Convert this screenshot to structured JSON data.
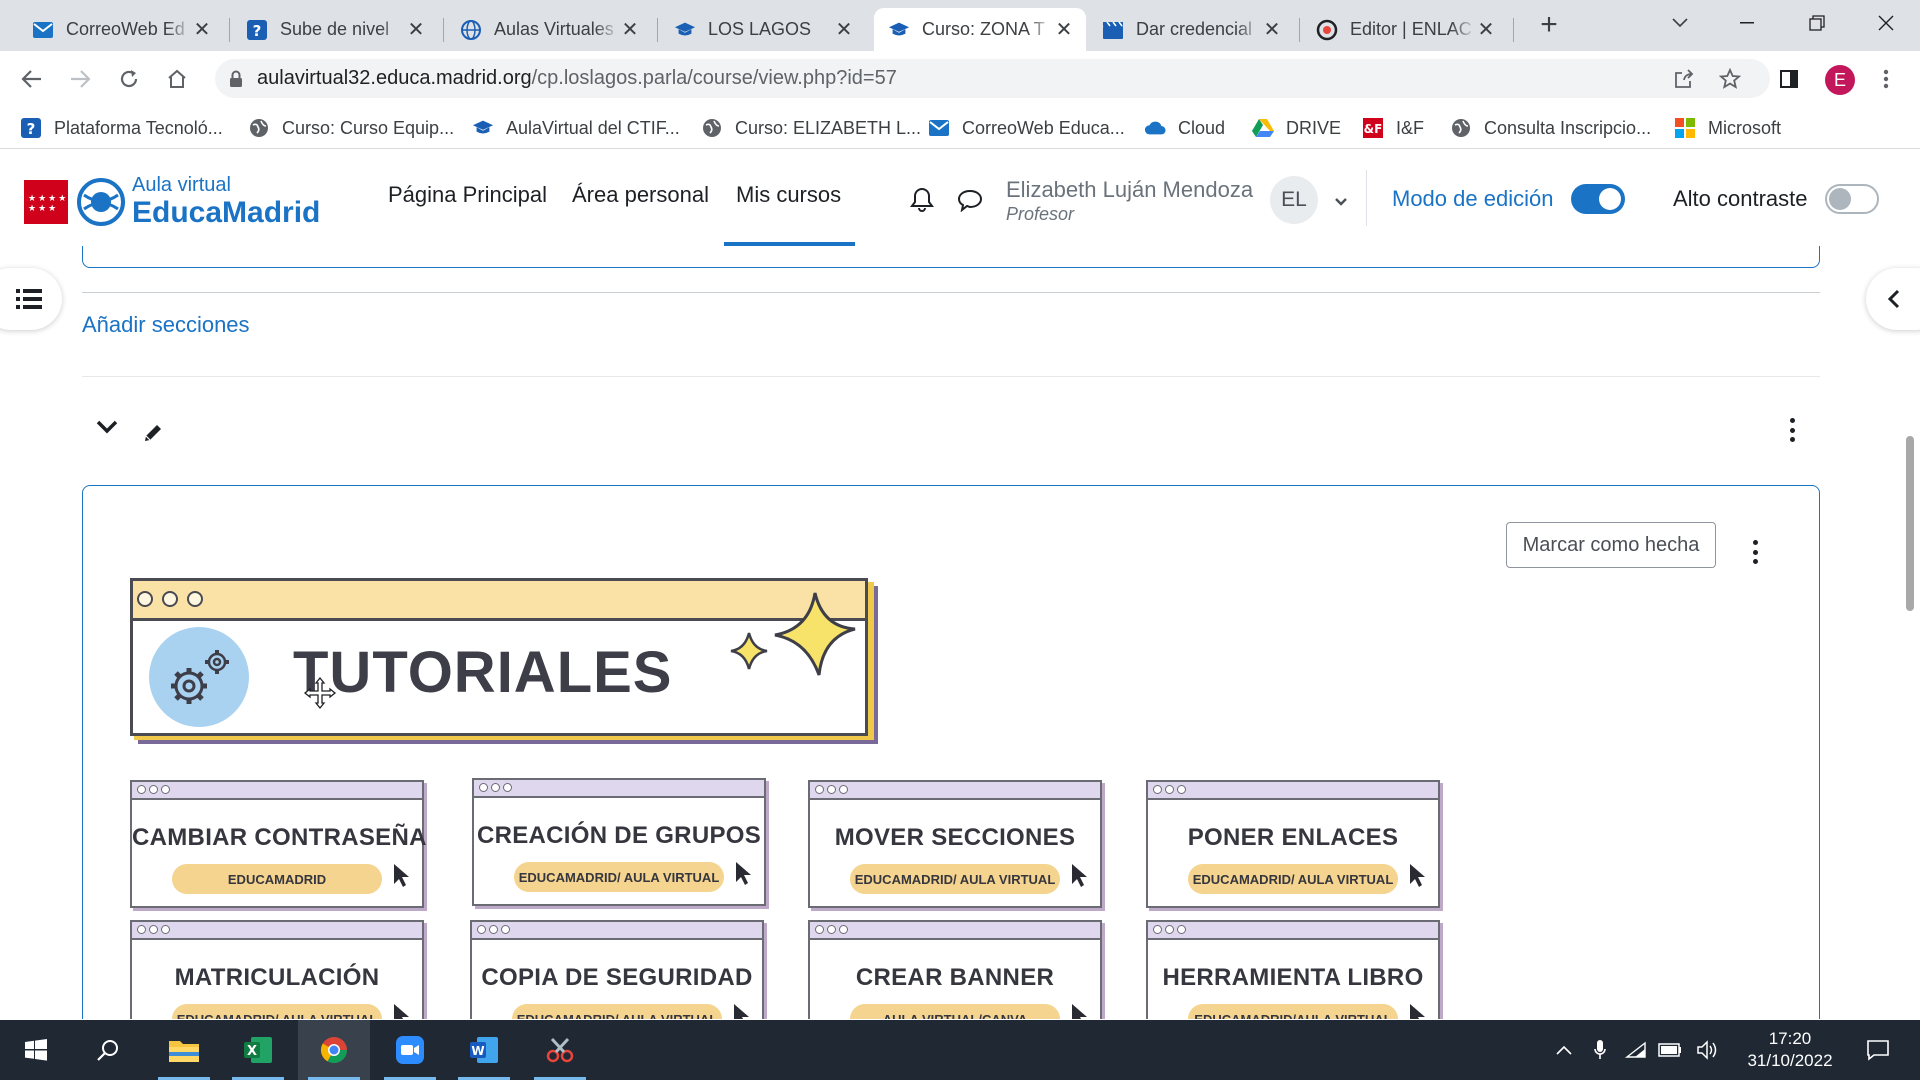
{
  "browser": {
    "tabs": [
      {
        "title": "CorreoWeb Ed",
        "icon": "mail-icon"
      },
      {
        "title": "Sube de nivel",
        "icon": "help-icon"
      },
      {
        "title": "Aulas Virtuales",
        "icon": "globe-icon"
      },
      {
        "title": "LOS LAGOS",
        "icon": "mortarboard-icon"
      },
      {
        "title": "Curso: ZONA T",
        "icon": "mortarboard-icon",
        "active": true
      },
      {
        "title": "Dar credencial",
        "icon": "clapper-icon"
      },
      {
        "title": "Editor | ENLAC",
        "icon": "editor-icon"
      }
    ],
    "url_host": "aulavirtual32.educa.madrid.org",
    "url_path": "/cp.loslagos.parla/course/view.php?id=57",
    "profile_initial": "E",
    "bookmarks": [
      {
        "label": "Plataforma Tecnoló...",
        "icon": "help-icon"
      },
      {
        "label": "Curso: Curso Equip...",
        "icon": "globe-icon"
      },
      {
        "label": "AulaVirtual del CTIF...",
        "icon": "mortarboard-icon"
      },
      {
        "label": "Curso: ELIZABETH L...",
        "icon": "globe-icon"
      },
      {
        "label": "CorreoWeb Educa...",
        "icon": "mail-icon"
      },
      {
        "label": "Cloud",
        "icon": "cloud-icon"
      },
      {
        "label": "DRIVE",
        "icon": "drive-icon"
      },
      {
        "label": "I&F",
        "icon": "if-icon"
      },
      {
        "label": "Consulta Inscripcio...",
        "icon": "globe-icon"
      },
      {
        "label": "Microsoft",
        "icon": "microsoft-icon"
      }
    ]
  },
  "site": {
    "brand_small": "Aula virtual",
    "brand_big": "EducaMadrid",
    "nav": [
      "Página Principal",
      "Área personal",
      "Mis cursos"
    ],
    "user_name": "Elizabeth Luján Mendoza",
    "user_role": "Profesor",
    "user_initials": "EL",
    "edit_mode_label": "Modo de edición",
    "edit_mode_on": true,
    "contrast_label": "Alto contraste",
    "contrast_on": false
  },
  "course": {
    "add_sections": "Añadir secciones",
    "mark_done": "Marcar como hecha",
    "banner_title": "TUTORIALES",
    "tiles": [
      {
        "title": "CAMBIAR CONTRASEÑA",
        "subtitle": "EDUCAMADRID"
      },
      {
        "title": "CREACIÓN DE GRUPOS",
        "subtitle": "EDUCAMADRID/ AULA VIRTUAL"
      },
      {
        "title": "MOVER SECCIONES",
        "subtitle": "EDUCAMADRID/ AULA VIRTUAL"
      },
      {
        "title": "PONER ENLACES",
        "subtitle": "EDUCAMADRID/ AULA VIRTUAL"
      },
      {
        "title": "MATRICULACIÓN",
        "subtitle": "EDUCAMADRID/ AULA VIRTUAL"
      },
      {
        "title": "COPIA DE SEGURIDAD",
        "subtitle": "EDUCAMADRID/ AULA VIRTUAL"
      },
      {
        "title": "CREAR BANNER",
        "subtitle": "AULA VIRTUAL/CANVA"
      },
      {
        "title": "HERRAMIENTA LIBRO",
        "subtitle": "EDUCAMADRID/AULA VIRTUAL"
      }
    ]
  },
  "taskbar": {
    "time": "17:20",
    "date": "31/10/2022"
  },
  "colors": {
    "accent": "#1a73c5",
    "brand_red": "#d0021b",
    "taskbar": "#1f2833"
  }
}
